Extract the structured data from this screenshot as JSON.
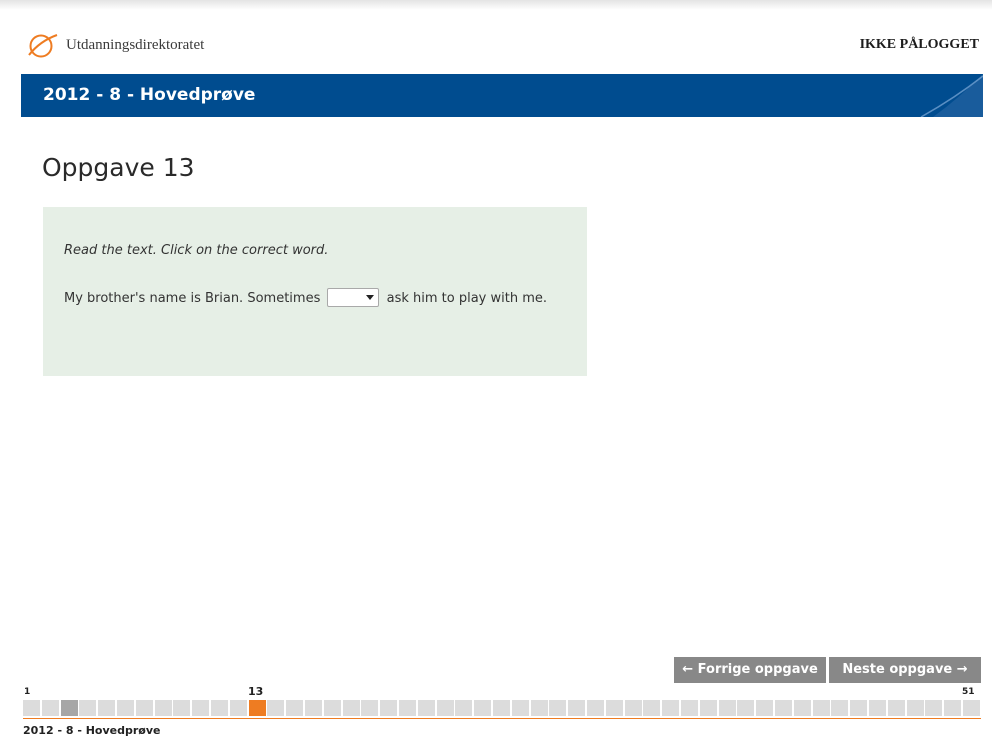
{
  "header": {
    "logo_text": "Utdanningsdirektoratet",
    "login_status": "IKKE PÅLOGGET"
  },
  "test": {
    "title": "2012 - 8 - Hovedprøve"
  },
  "task": {
    "title": "Oppgave 13",
    "instruction": "Read the text. Click on the correct word.",
    "sentence_before": "My brother's name is Brian. Sometimes",
    "sentence_after": "ask him to play with me.",
    "selected_value": ""
  },
  "navigation": {
    "prev_label": "Forrige oppgave",
    "next_label": "Neste oppgave"
  },
  "progress": {
    "first": "1",
    "last": "51",
    "current": "13",
    "total": 51,
    "current_index": 13,
    "visited": [
      3
    ]
  },
  "footer": {
    "title": "2012 - 8 - Hovedprøve"
  },
  "colors": {
    "title_bar": "#004c8f",
    "question_bg": "#e6efe6",
    "nav_button": "#888888",
    "progress_cell": "#dcdcdc",
    "progress_visited": "#a6a6a6",
    "progress_current": "#ee7c22",
    "logo_accent": "#ee7c22"
  }
}
